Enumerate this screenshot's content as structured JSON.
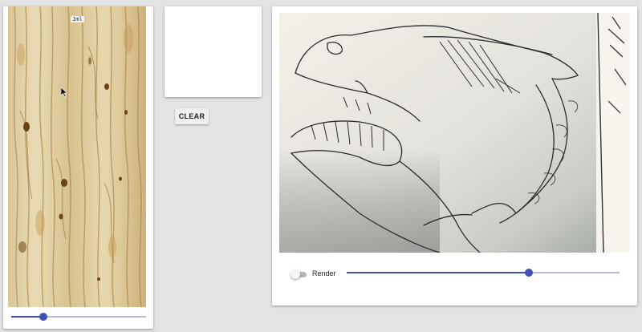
{
  "wood_panel": {
    "tag_text": "1ml"
  },
  "wood_slider": {
    "value_fraction": 0.24
  },
  "clear_button": {
    "label": "CLEAR"
  },
  "render": {
    "toggle_label": "Render",
    "toggle_on": false,
    "slider_value_fraction": 0.667
  },
  "colors": {
    "accent": "#3f51b5",
    "background": "#e3e2e4",
    "card": "#ffffff"
  },
  "icons": {
    "cursor": "arrow-pointer-icon"
  }
}
